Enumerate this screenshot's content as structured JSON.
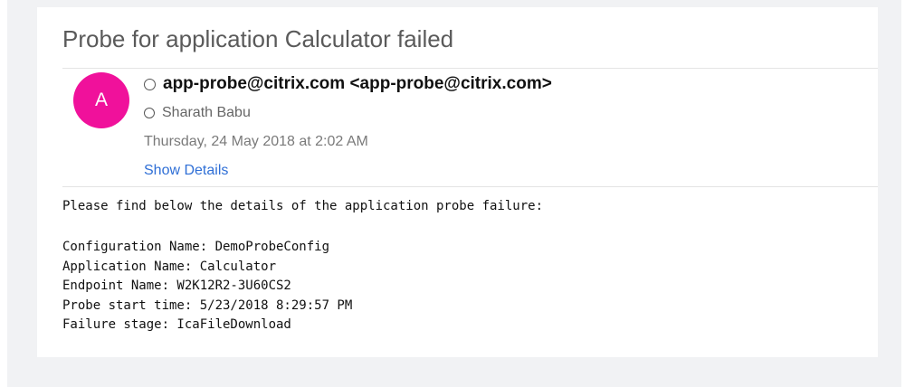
{
  "email": {
    "subject": "Probe for application Calculator failed",
    "avatar_initial": "A",
    "from": "app-probe@citrix.com <app-probe@citrix.com>",
    "to": "Sharath Babu",
    "date": "Thursday, 24 May 2018 at 2:02 AM",
    "show_details_label": "Show Details",
    "body": {
      "intro": "Please find below the details of the application probe failure:",
      "lines": [
        "Configuration Name: DemoProbeConfig",
        "Application Name: Calculator",
        "Endpoint Name: W2K12R2-3U60CS2",
        "Probe start time: 5/23/2018 8:29:57 PM",
        "Failure stage: IcaFileDownload"
      ]
    }
  },
  "colors": {
    "avatar": "#f0119b",
    "link": "#2f6fd6",
    "background": "#f1f2f4"
  },
  "icons": {
    "from_status": "ring-icon",
    "to_status": "ring-icon"
  }
}
